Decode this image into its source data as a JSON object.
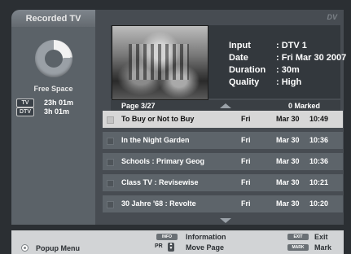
{
  "left_panel": {
    "tab_label": "Recorded TV",
    "free_space_label": "Free Space",
    "free_space_fraction": 0.24,
    "space": [
      {
        "badge": "TV",
        "value": "23h 01m"
      },
      {
        "badge": "DTV",
        "value": "3h 01m"
      }
    ]
  },
  "main": {
    "logo_text": "DV",
    "info": [
      {
        "key": "Input",
        "value": ": DTV 1"
      },
      {
        "key": "Date",
        "value": ": Fri Mar 30 2007"
      },
      {
        "key": "Duration",
        "value": ": 30m"
      },
      {
        "key": "Quality",
        "value": ": High"
      }
    ],
    "page_label": "Page  3/27",
    "marked_label": "0 Marked",
    "rows": [
      {
        "title": "To Buy or Not to Buy",
        "day": "Fri",
        "date": "Mar 30",
        "time": "10:49",
        "selected": true
      },
      {
        "title": "In the Night Garden",
        "day": "Fri",
        "date": "Mar 30",
        "time": "10:36",
        "selected": false
      },
      {
        "title": "Schools : Primary Geog",
        "day": "Fri",
        "date": "Mar 30",
        "time": "10:36",
        "selected": false
      },
      {
        "title": "Class TV : Revisewise",
        "day": "Fri",
        "date": "Mar 30",
        "time": "10:21",
        "selected": false
      },
      {
        "title": "30 Jahre '68 : Revolte",
        "day": "Fri",
        "date": "Mar 30",
        "time": "10:20",
        "selected": false
      }
    ]
  },
  "help": {
    "popup_label": "Popup Menu",
    "info_key": "INFO",
    "info_label": "Information",
    "pr_key": "PR",
    "move_label": "Move Page",
    "exit_key": "EXIT",
    "exit_label": "Exit",
    "mark_key": "MARK",
    "mark_label": "Mark"
  },
  "colors": {
    "background": "#2b2f33",
    "panel": "#474c52",
    "row": "#5d646a",
    "row_selected": "#d7d7d7",
    "help_bar": "#d2d4d6"
  }
}
